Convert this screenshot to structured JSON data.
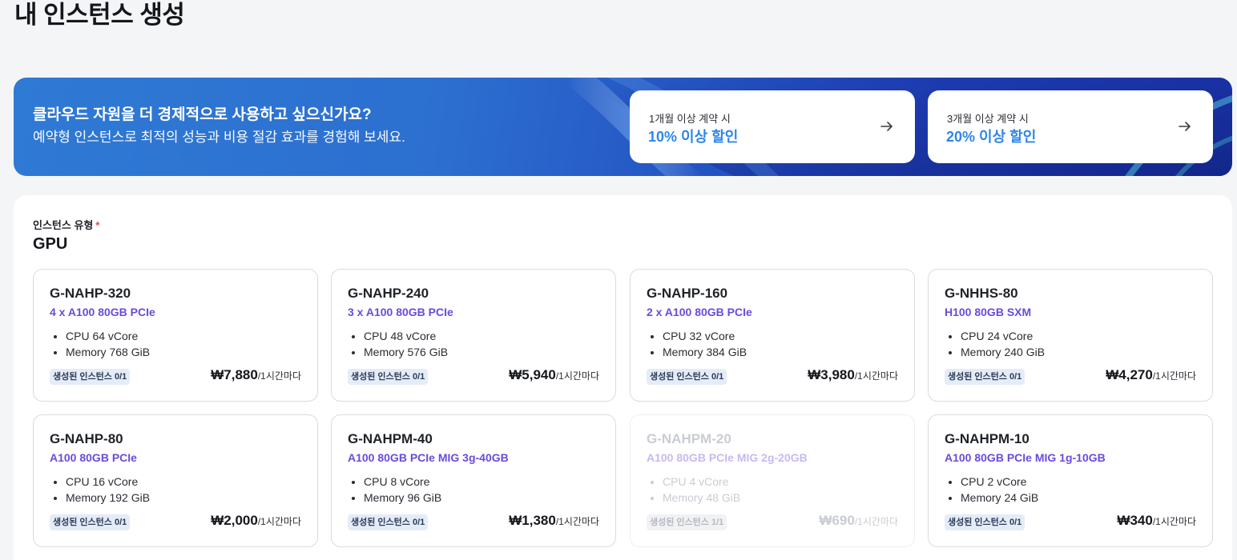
{
  "page": {
    "title": "내 인스턴스 생성"
  },
  "banner": {
    "headline": "클라우드 자원을 더 경제적으로 사용하고 싶으신가요?",
    "subtext": "예약형 인스턴스로 최적의 성능과 비용 절감 효과를 경험해 보세요.",
    "promos": [
      {
        "label": "1개월 이상 계약 시",
        "value": "10% 이상 할인",
        "icon": "arrow-right-icon"
      },
      {
        "label": "3개월 이상 계약 시",
        "value": "20% 이상 할인",
        "icon": "arrow-right-icon"
      }
    ]
  },
  "form": {
    "field_label": "인스턴스 유형",
    "required_mark": "*",
    "category": "GPU"
  },
  "colors": {
    "accent": "#2f86e6",
    "gpu_text": "#6a4bdc",
    "required": "#e5484d"
  },
  "cards": [
    {
      "name": "G-NAHP-320",
      "gpu": "4 x A100 80GB PCIe",
      "cpu": "CPU 64 vCore",
      "memory": "Memory 768 GiB",
      "badge": "생성된 인스턴스 0/1",
      "price": "₩7,880",
      "unit": "/1시간마다",
      "disabled": false
    },
    {
      "name": "G-NAHP-240",
      "gpu": "3 x A100 80GB PCIe",
      "cpu": "CPU 48 vCore",
      "memory": "Memory 576 GiB",
      "badge": "생성된 인스턴스 0/1",
      "price": "₩5,940",
      "unit": "/1시간마다",
      "disabled": false
    },
    {
      "name": "G-NAHP-160",
      "gpu": "2 x A100 80GB PCIe",
      "cpu": "CPU 32 vCore",
      "memory": "Memory 384 GiB",
      "badge": "생성된 인스턴스 0/1",
      "price": "₩3,980",
      "unit": "/1시간마다",
      "disabled": false
    },
    {
      "name": "G-NHHS-80",
      "gpu": "H100 80GB SXM",
      "cpu": "CPU 24 vCore",
      "memory": "Memory 240 GiB",
      "badge": "생성된 인스턴스 0/1",
      "price": "₩4,270",
      "unit": "/1시간마다",
      "disabled": false
    },
    {
      "name": "G-NAHP-80",
      "gpu": "A100 80GB PCIe",
      "cpu": "CPU 16 vCore",
      "memory": "Memory 192 GiB",
      "badge": "생성된 인스턴스 0/1",
      "price": "₩2,000",
      "unit": "/1시간마다",
      "disabled": false
    },
    {
      "name": "G-NAHPM-40",
      "gpu": "A100 80GB PCIe MIG 3g-40GB",
      "cpu": "CPU 8 vCore",
      "memory": "Memory 96 GiB",
      "badge": "생성된 인스턴스 0/1",
      "price": "₩1,380",
      "unit": "/1시간마다",
      "disabled": false
    },
    {
      "name": "G-NAHPM-20",
      "gpu": "A100 80GB PCIe MIG 2g-20GB",
      "cpu": "CPU 4 vCore",
      "memory": "Memory 48 GiB",
      "badge": "생성된 인스턴스 1/1",
      "price": "₩690",
      "unit": "/1시간마다",
      "disabled": true
    },
    {
      "name": "G-NAHPM-10",
      "gpu": "A100 80GB PCIe MIG 1g-10GB",
      "cpu": "CPU 2 vCore",
      "memory": "Memory 24 GiB",
      "badge": "생성된 인스턴스 0/1",
      "price": "₩340",
      "unit": "/1시간마다",
      "disabled": false
    }
  ]
}
